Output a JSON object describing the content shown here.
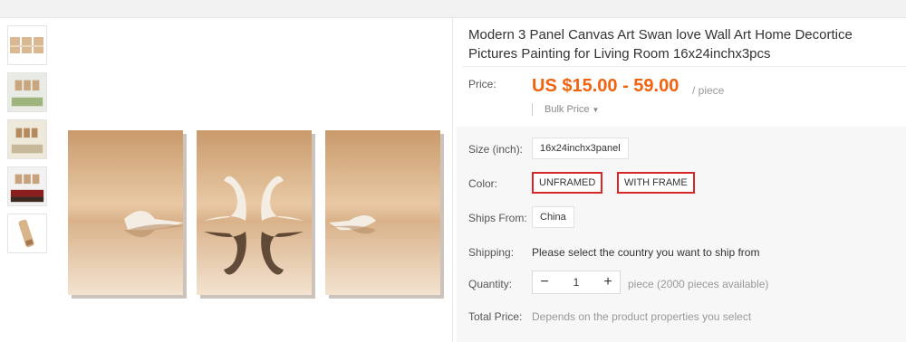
{
  "product": {
    "title": "Modern 3 Panel Canvas Art Swan love Wall Art Home Decortice Pictures Painting for Living Room 16x24inchx3pcs"
  },
  "price": {
    "label": "Price:",
    "value": "US $15.00 - 59.00",
    "unit": "/ piece",
    "bulk_label": "Bulk Price",
    "accent_color": "#f2630f"
  },
  "gallery": {
    "thumbnails": [
      "3-panel-swan-canvas",
      "living-room-preview",
      "sofa-room-preview",
      "red-room-preview",
      "canvas-roll-detail"
    ]
  },
  "properties": {
    "size": {
      "label": "Size (inch):",
      "options": [
        "16x24inchx3panel"
      ]
    },
    "color": {
      "label": "Color:",
      "options": [
        "UNFRAMED",
        "WITH FRAME"
      ],
      "highlight_color": "#d62828"
    },
    "ships_from": {
      "label": "Ships From:",
      "options": [
        "China"
      ]
    },
    "shipping": {
      "label": "Shipping:",
      "text": "Please select the country you want to ship from"
    },
    "quantity": {
      "label": "Quantity:",
      "minus": "−",
      "value": "1",
      "plus": "+",
      "availability": "piece (2000 pieces available)"
    },
    "total": {
      "label": "Total Price:",
      "text": "Depends on the product properties you select"
    }
  }
}
